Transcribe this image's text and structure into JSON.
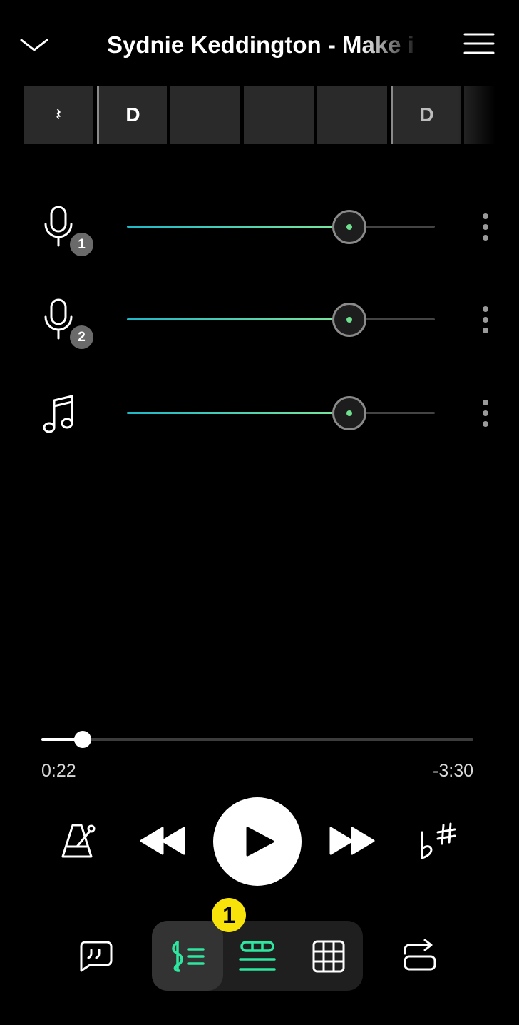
{
  "header": {
    "title": "Sydnie Keddington - Make it to Me",
    "collapse_icon": "chevron-down-icon",
    "menu_icon": "hamburger-menu-icon"
  },
  "chord_strip": [
    {
      "label": "𝄽",
      "bar_start": false,
      "dim": false
    },
    {
      "label": "D",
      "bar_start": true,
      "dim": false
    },
    {
      "label": "",
      "bar_start": false,
      "dim": false
    },
    {
      "label": "",
      "bar_start": false,
      "dim": false
    },
    {
      "label": "",
      "bar_start": false,
      "dim": false
    },
    {
      "label": "D",
      "bar_start": true,
      "dim": true
    },
    {
      "label": "",
      "bar_start": false,
      "dim": false
    }
  ],
  "mixer": [
    {
      "icon": "microphone-icon",
      "badge": "1",
      "level": 0.72
    },
    {
      "icon": "microphone-icon",
      "badge": "2",
      "level": 0.72
    },
    {
      "icon": "music-note-icon",
      "badge": "",
      "level": 0.72
    }
  ],
  "playback": {
    "elapsed": "0:22",
    "remaining": "-3:30",
    "progress": 0.095
  },
  "callout": {
    "label": "1"
  },
  "colors": {
    "accent": "#2ee6a0",
    "slider_start": "#1fb7c9",
    "slider_end": "#7ee89a",
    "callout": "#f7e20a"
  }
}
